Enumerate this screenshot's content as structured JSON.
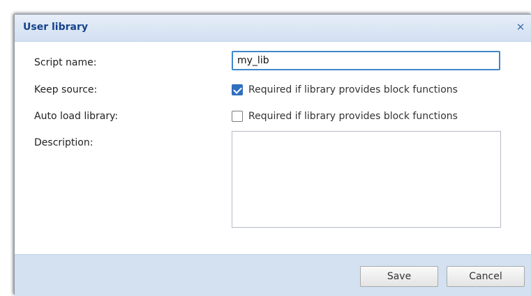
{
  "dialog": {
    "title": "User library",
    "close_icon": "close-icon",
    "close_glyph": "✕"
  },
  "form": {
    "script_name_label": "Script name:",
    "script_name_value": "my_lib",
    "keep_source_label": "Keep source:",
    "keep_source_checked": true,
    "keep_source_hint": "Required if library provides block functions",
    "auto_load_label": "Auto load library:",
    "auto_load_checked": false,
    "auto_load_hint": "Required if library provides block functions",
    "description_label": "Description:",
    "description_value": ""
  },
  "buttons": {
    "save_label": "Save",
    "cancel_label": "Cancel"
  },
  "colors": {
    "title_text": "#15428b",
    "header_bg": "#d2e0f1",
    "footer_bg": "#d3e1f1",
    "checkbox_checked": "#2f6fbf",
    "input_focus_border": "#3f86c9"
  }
}
